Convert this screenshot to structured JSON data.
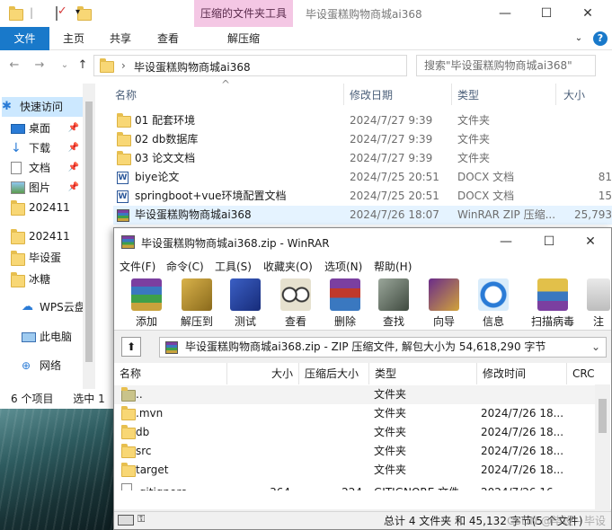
{
  "explorer": {
    "context_tab": "压缩的文件夹工具",
    "window_title": "毕设蛋糕购物商城ai368",
    "ribbon_tabs": [
      "文件",
      "主页",
      "共享",
      "查看",
      "解压缩"
    ],
    "address": "毕设蛋糕购物商城ai368",
    "search_placeholder": "搜索\"毕设蛋糕购物商城ai368\"",
    "columns": {
      "name": "名称",
      "date": "修改日期",
      "type": "类型",
      "size": "大小"
    },
    "files": [
      {
        "name": "01 配套环境",
        "date": "2024/7/27 9:39",
        "type": "文件夹",
        "size": "",
        "icon": "folder-icon"
      },
      {
        "name": "02 db数据库",
        "date": "2024/7/27 9:39",
        "type": "文件夹",
        "size": "",
        "icon": "folder-icon"
      },
      {
        "name": "03 论文文档",
        "date": "2024/7/27 9:39",
        "type": "文件夹",
        "size": "",
        "icon": "folder-icon"
      },
      {
        "name": "biye论文",
        "date": "2024/7/25 20:51",
        "type": "DOCX 文档",
        "size": "81",
        "icon": "docx-icon"
      },
      {
        "name": "springboot+vue环境配置文档",
        "date": "2024/7/25 20:51",
        "type": "DOCX 文档",
        "size": "15",
        "icon": "docx-icon"
      },
      {
        "name": "毕设蛋糕购物商城ai368",
        "date": "2024/7/26 18:07",
        "type": "WinRAR ZIP 压缩...",
        "size": "25,793",
        "icon": "winrar-icon"
      }
    ],
    "nav": [
      {
        "label": "快速访问",
        "icon": "star-icon"
      },
      {
        "label": "桌面",
        "icon": "desktop-icon"
      },
      {
        "label": "下载",
        "icon": "download-icon"
      },
      {
        "label": "文档",
        "icon": "document-icon"
      },
      {
        "label": "图片",
        "icon": "picture-icon"
      },
      {
        "label": "202411",
        "icon": "folder-icon"
      },
      {
        "label": "202411",
        "icon": "folder-icon"
      },
      {
        "label": "毕设蛋",
        "icon": "folder-icon"
      },
      {
        "label": "冰糖",
        "icon": "folder-icon"
      },
      {
        "label": "WPS云盘",
        "icon": "cloud-icon"
      },
      {
        "label": "此电脑",
        "icon": "computer-icon"
      },
      {
        "label": "网络",
        "icon": "network-icon"
      }
    ],
    "status_items": "6 个项目",
    "status_selected": "选中 1"
  },
  "winrar": {
    "title": "毕设蛋糕购物商城ai368.zip - WinRAR",
    "menu": [
      "文件(F)",
      "命令(C)",
      "工具(S)",
      "收藏夹(O)",
      "选项(N)",
      "帮助(H)"
    ],
    "tools": [
      "添加",
      "解压到",
      "测试",
      "查看",
      "删除",
      "查找",
      "向导",
      "信息",
      "扫描病毒",
      "注"
    ],
    "path": "毕设蛋糕购物商城ai368.zip - ZIP 压缩文件, 解包大小为 54,618,290 字节",
    "columns": {
      "name": "名称",
      "size": "大小",
      "packed": "压缩后大小",
      "type": "类型",
      "mtime": "修改时间",
      "crc": "CRC"
    },
    "rows": [
      {
        "name": "..",
        "size": "",
        "packed": "",
        "type": "文件夹",
        "mtime": ""
      },
      {
        "name": ".mvn",
        "size": "",
        "packed": "",
        "type": "文件夹",
        "mtime": "2024/7/26 18..."
      },
      {
        "name": "db",
        "size": "",
        "packed": "",
        "type": "文件夹",
        "mtime": "2024/7/26 18..."
      },
      {
        "name": "src",
        "size": "",
        "packed": "",
        "type": "文件夹",
        "mtime": "2024/7/26 18..."
      },
      {
        "name": "target",
        "size": "",
        "packed": "",
        "type": "文件夹",
        "mtime": "2024/7/26 18..."
      },
      {
        "name": ".gitignore",
        "size": "364",
        "packed": "224",
        "type": "GITIGNORE 文件",
        "mtime": "2024/7/26 16..."
      }
    ],
    "status": "总计 4 文件夹 和 45,132 字节(5 个文件)",
    "watermark": "CSDN @毕设 - 毕设"
  },
  "colors": {
    "accent": "#1979ca",
    "context_tab": "#f4c7e4",
    "selection": "#cce8ff"
  }
}
